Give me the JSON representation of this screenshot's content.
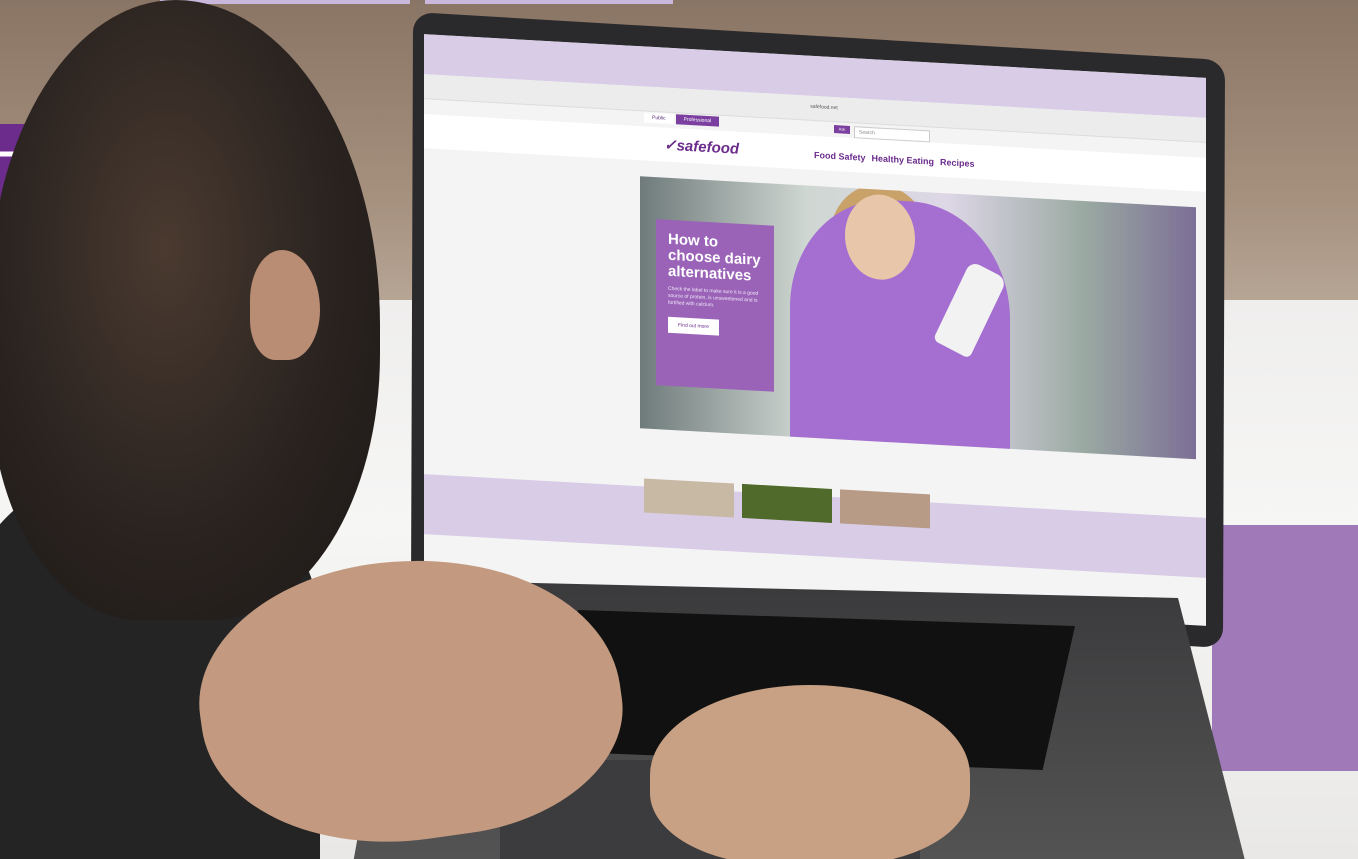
{
  "browser": {
    "url": "safefood.net"
  },
  "site": {
    "tabs": [
      {
        "label": "Public"
      },
      {
        "label": "Professional"
      }
    ],
    "search_placeholder": "Search",
    "search_badge": "Ask",
    "logo_text": "safefood",
    "nav": [
      {
        "label": "Food Safety"
      },
      {
        "label": "Healthy Eating"
      },
      {
        "label": "Recipes"
      }
    ]
  },
  "hero": {
    "title": "How to choose dairy alternatives",
    "text": "Check the label to make sure it is a good source of protein, is unsweetened and is fortified with calcium.",
    "button": "Find out more"
  },
  "colors": {
    "brand_purple": "#6b2c8c",
    "light_purple": "#d8cce6",
    "card_purple": "#9a63b8"
  }
}
